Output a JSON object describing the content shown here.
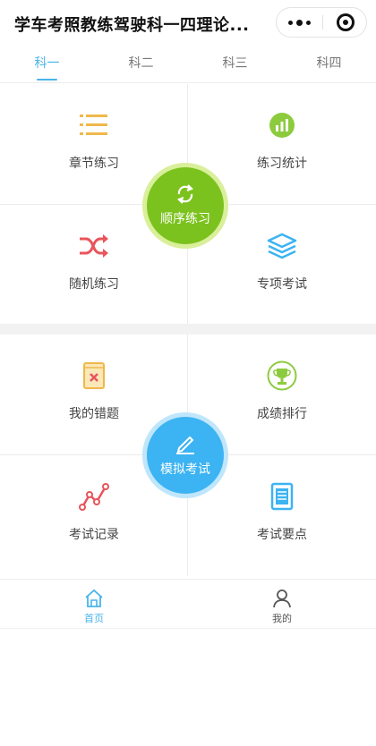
{
  "header": {
    "title": "学车考照教练驾驶科一四理论..."
  },
  "tabs": [
    {
      "label": "科一",
      "active": true
    },
    {
      "label": "科二",
      "active": false
    },
    {
      "label": "科三",
      "active": false
    },
    {
      "label": "科四",
      "active": false
    }
  ],
  "section1": {
    "items": [
      {
        "label": "章节练习",
        "icon": "list-icon"
      },
      {
        "label": "练习统计",
        "icon": "bar-chart-icon"
      },
      {
        "label": "随机练习",
        "icon": "shuffle-icon"
      },
      {
        "label": "专项考试",
        "icon": "layers-icon"
      }
    ],
    "center": {
      "label": "顺序练习",
      "icon": "refresh-icon",
      "color": "#7cc21e"
    }
  },
  "section2": {
    "items": [
      {
        "label": "我的错题",
        "icon": "wrong-book-icon"
      },
      {
        "label": "成绩排行",
        "icon": "trophy-icon"
      },
      {
        "label": "考试记录",
        "icon": "line-chart-icon"
      },
      {
        "label": "考试要点",
        "icon": "document-icon"
      }
    ],
    "center": {
      "label": "模拟考试",
      "icon": "pen-icon",
      "color": "#3cb3f2"
    }
  },
  "bottom_nav": [
    {
      "label": "首页",
      "icon": "home-icon",
      "active": true
    },
    {
      "label": "我的",
      "icon": "user-icon",
      "active": false
    }
  ],
  "colors": {
    "accent": "#48b4ea",
    "green": "#7cc21e",
    "blue": "#3cb3f2",
    "orange": "#f0b84a",
    "red": "#e8555b"
  }
}
